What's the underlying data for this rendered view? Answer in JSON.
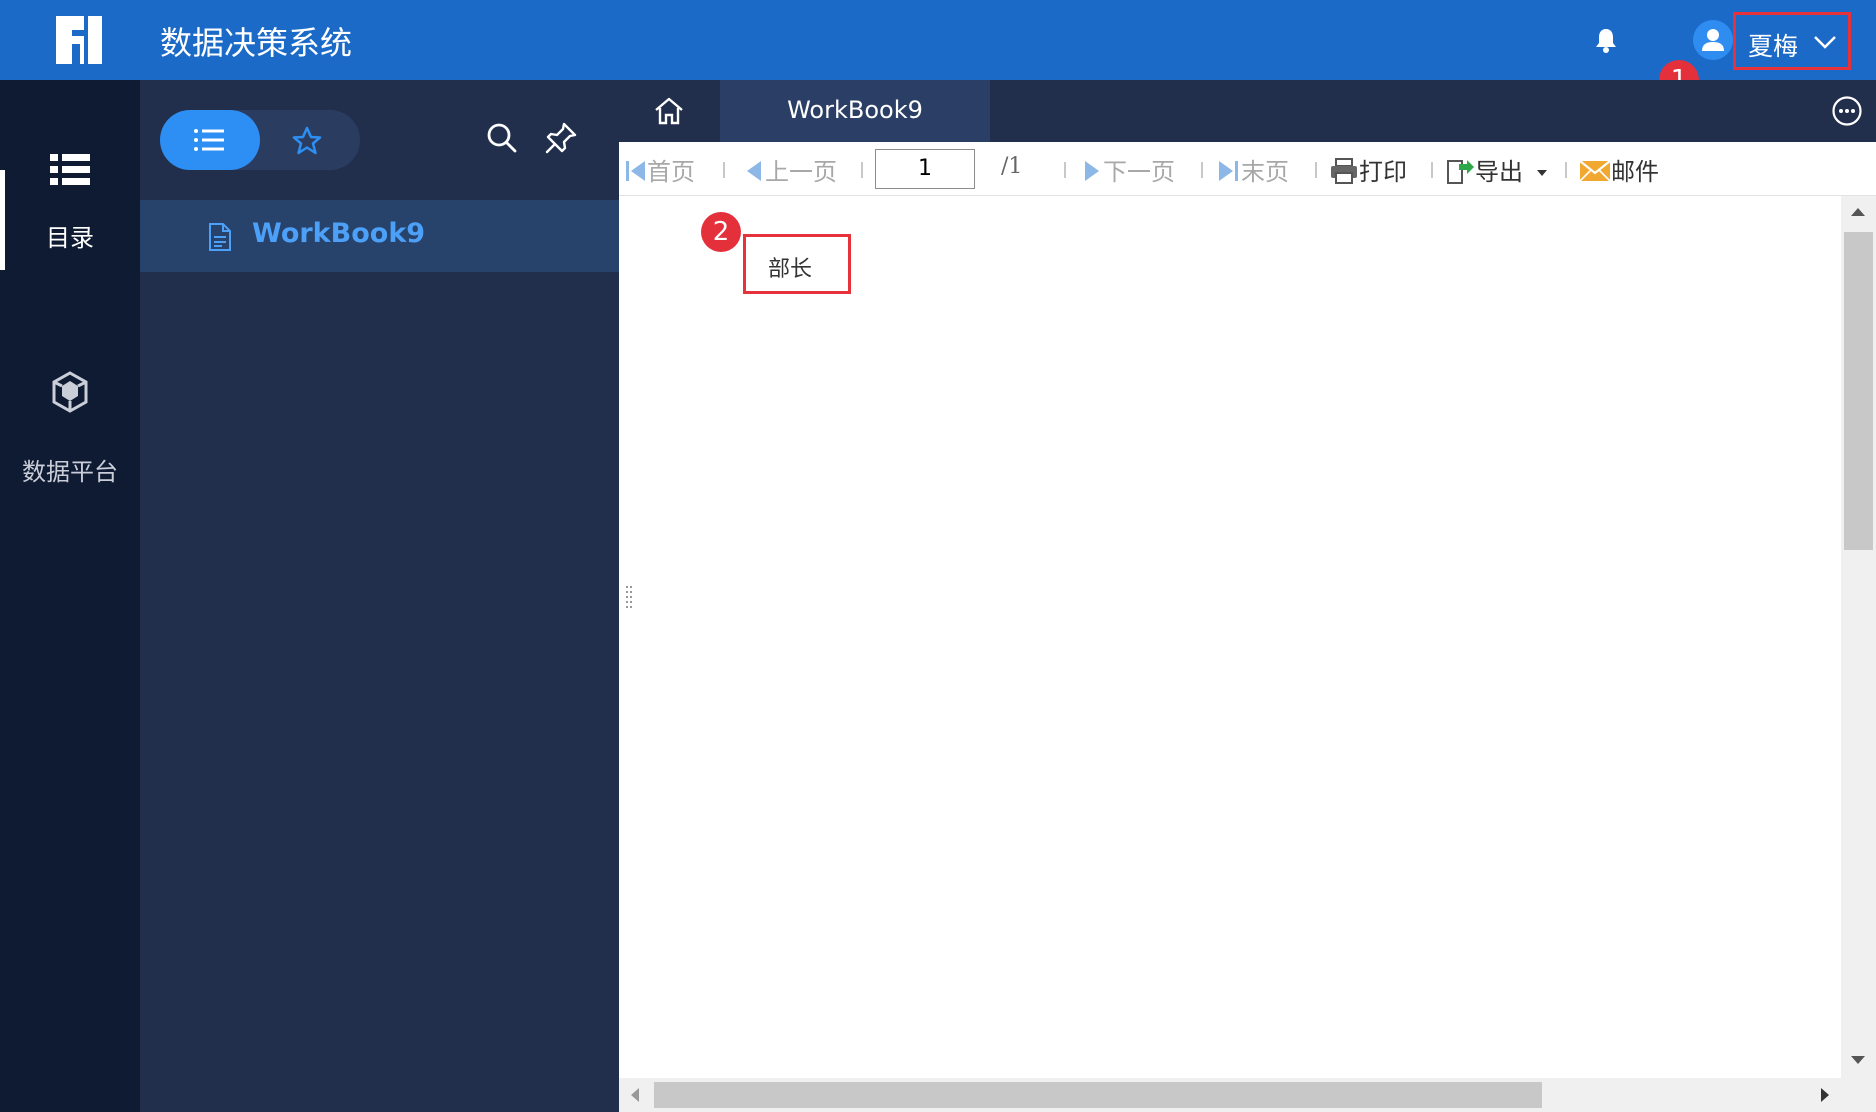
{
  "header": {
    "app_title": "数据决策系统",
    "user_name": "夏梅",
    "annotation_1": "1",
    "brand_color": "#1c6ac8"
  },
  "rail": {
    "items": [
      {
        "label": "目录",
        "icon": "catalog-list-icon",
        "active": true
      },
      {
        "label": "数据平台",
        "icon": "data-platform-cube-icon",
        "active": false
      }
    ]
  },
  "catalog": {
    "view_icons": [
      "list-view-icon",
      "favorites-star-icon"
    ],
    "tool_icons": [
      "search-icon",
      "pin-icon"
    ],
    "items": [
      {
        "label": "WorkBook9",
        "icon": "report-file-icon",
        "selected": true
      }
    ]
  },
  "tabs": {
    "home_icon": "home-icon",
    "active_tab": "WorkBook9",
    "more_icon": "more-options-icon"
  },
  "toolbar": {
    "first_page": "首页",
    "prev_page": "上一页",
    "current_page": "1",
    "total_pages": "/1",
    "next_page": "下一页",
    "last_page": "末页",
    "print": "打印",
    "export": "导出",
    "email": "邮件"
  },
  "report": {
    "annotation_2": "2",
    "cell_value": "部长"
  },
  "colors": {
    "accent": "#2d8ef3",
    "highlight_border": "#e6323a",
    "panel_bg": "#212f4c",
    "rail_bg": "#0f1a33"
  }
}
